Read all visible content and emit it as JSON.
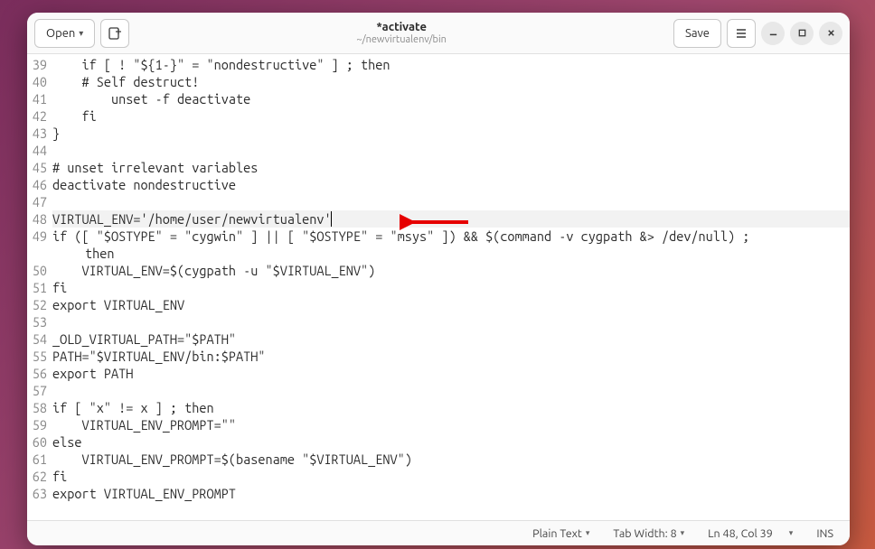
{
  "titlebar": {
    "open_label": "Open",
    "save_label": "Save",
    "title": "*activate",
    "subtitle": "~/newvirtualenv/bin"
  },
  "editor": {
    "first_line_number": 39,
    "highlighted_line": 48,
    "lines": [
      {
        "n": 39,
        "text": "    if [ ! \"${1-}\" = \"nondestructive\" ] ; then"
      },
      {
        "n": 40,
        "text": "    # Self destruct!"
      },
      {
        "n": 41,
        "text": "        unset -f deactivate"
      },
      {
        "n": 42,
        "text": "    fi"
      },
      {
        "n": 43,
        "text": "}"
      },
      {
        "n": 44,
        "text": ""
      },
      {
        "n": 45,
        "text": "# unset irrelevant variables"
      },
      {
        "n": 46,
        "text": "deactivate nondestructive"
      },
      {
        "n": 47,
        "text": ""
      },
      {
        "n": 48,
        "text": "VIRTUAL_ENV='/home/user/newvirtualenv'"
      },
      {
        "n": 49,
        "text": "if ([ \"$OSTYPE\" = \"cygwin\" ] || [ \"$OSTYPE\" = \"msys\" ]) && $(command -v cygpath &> /dev/null) ;"
      },
      {
        "n": -1,
        "text": "then",
        "wrap": true
      },
      {
        "n": 50,
        "text": "    VIRTUAL_ENV=$(cygpath -u \"$VIRTUAL_ENV\")"
      },
      {
        "n": 51,
        "text": "fi"
      },
      {
        "n": 52,
        "text": "export VIRTUAL_ENV"
      },
      {
        "n": 53,
        "text": ""
      },
      {
        "n": 54,
        "text": "_OLD_VIRTUAL_PATH=\"$PATH\""
      },
      {
        "n": 55,
        "text": "PATH=\"$VIRTUAL_ENV/bin:$PATH\""
      },
      {
        "n": 56,
        "text": "export PATH"
      },
      {
        "n": 57,
        "text": ""
      },
      {
        "n": 58,
        "text": "if [ \"x\" != x ] ; then"
      },
      {
        "n": 59,
        "text": "    VIRTUAL_ENV_PROMPT=\"\""
      },
      {
        "n": 60,
        "text": "else"
      },
      {
        "n": 61,
        "text": "    VIRTUAL_ENV_PROMPT=$(basename \"$VIRTUAL_ENV\")"
      },
      {
        "n": 62,
        "text": "fi"
      },
      {
        "n": 63,
        "text": "export VIRTUAL_ENV_PROMPT"
      }
    ]
  },
  "statusbar": {
    "language": "Plain Text",
    "tab_width": "Tab Width: 8",
    "position": "Ln 48, Col 39",
    "insert_mode": "INS"
  },
  "annotation": {
    "arrow_color": "#e60000"
  }
}
